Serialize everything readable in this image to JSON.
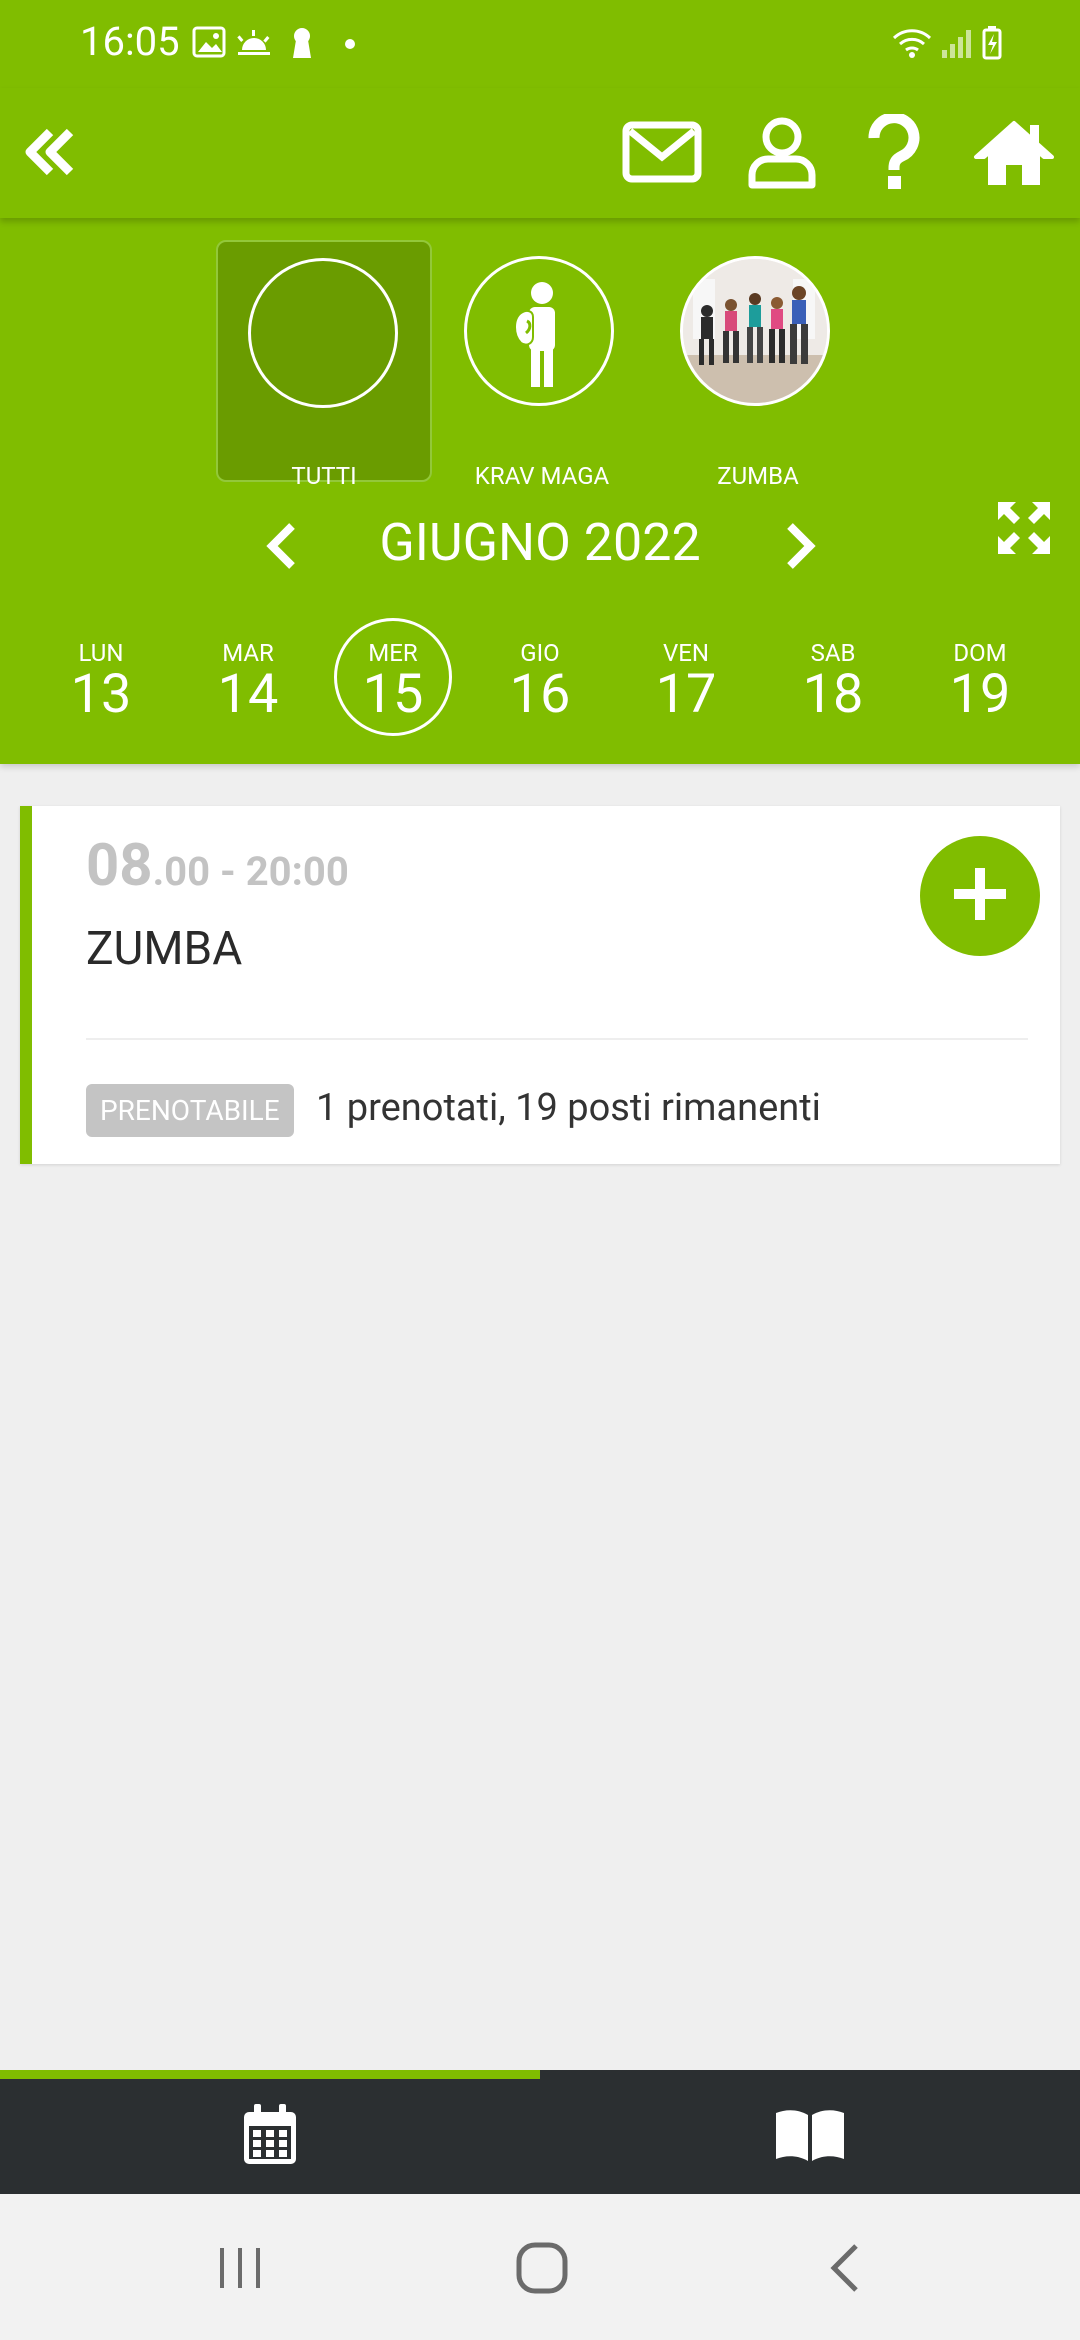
{
  "status_bar": {
    "time": "16:05"
  },
  "categories": [
    {
      "label": "TUTTI",
      "selected": true
    },
    {
      "label": "KRAV MAGA",
      "selected": false
    },
    {
      "label": "ZUMBA",
      "selected": false
    }
  ],
  "calendar": {
    "month_label": "GIUGNO 2022",
    "days": [
      {
        "name": "LUN",
        "num": "13"
      },
      {
        "name": "MAR",
        "num": "14"
      },
      {
        "name": "MER",
        "num": "15"
      },
      {
        "name": "GIO",
        "num": "16"
      },
      {
        "name": "VEN",
        "num": "17"
      },
      {
        "name": "SAB",
        "num": "18"
      },
      {
        "name": "DOM",
        "num": "19"
      }
    ],
    "selected_day": "15"
  },
  "event": {
    "start_hour": "08",
    "time_rest": ".00 - 20:00",
    "title": "ZUMBA",
    "badge": "PRENOTABILE",
    "info": "1 prenotati, 19 posti rimanenti"
  },
  "colors": {
    "accent": "#80bd00",
    "dark_nav": "#2b2f31",
    "background": "#efefef"
  }
}
